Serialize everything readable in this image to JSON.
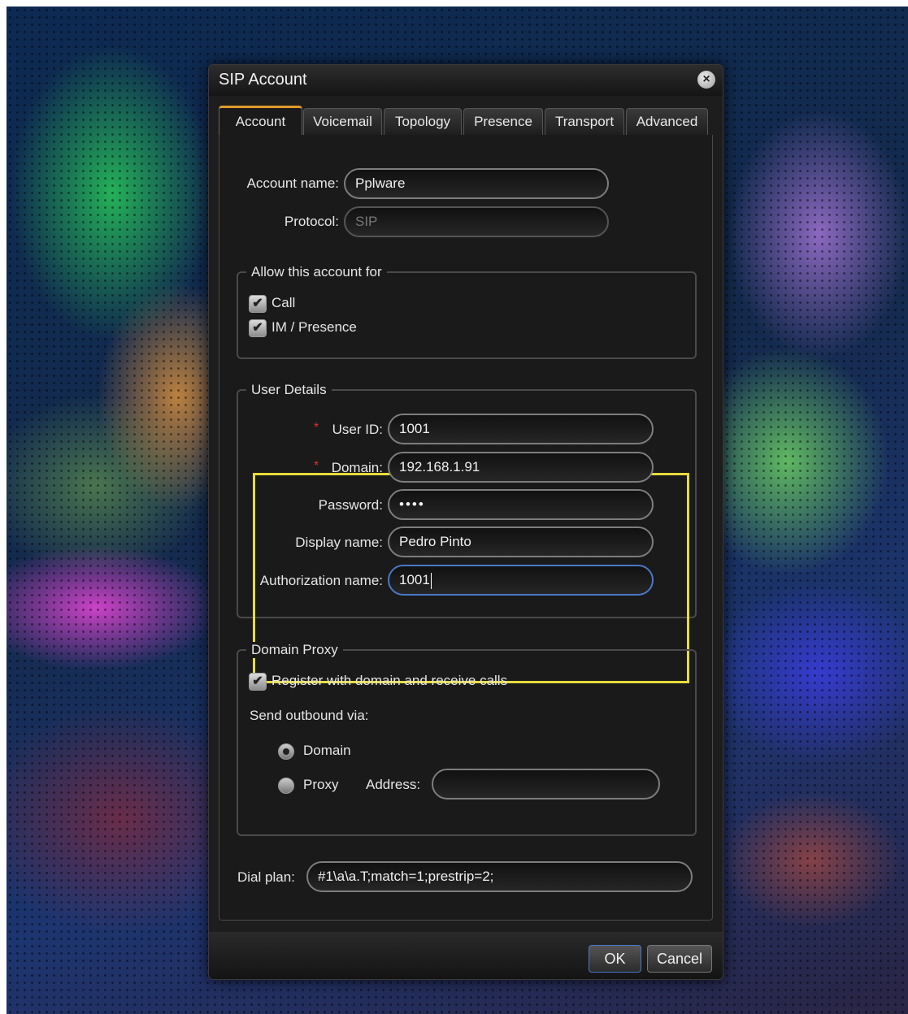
{
  "dialog": {
    "title": "SIP Account",
    "close_icon": "×"
  },
  "tabs": [
    {
      "label": "Account",
      "active": true
    },
    {
      "label": "Voicemail"
    },
    {
      "label": "Topology"
    },
    {
      "label": "Presence"
    },
    {
      "label": "Transport"
    },
    {
      "label": "Advanced"
    }
  ],
  "account": {
    "account_name_label": "Account name:",
    "account_name_value": "Pplware",
    "protocol_label": "Protocol:",
    "protocol_value": "SIP"
  },
  "allow": {
    "title": "Allow this account for",
    "call_label": "Call",
    "im_label": "IM / Presence",
    "call_checked": true,
    "im_checked": true,
    "check_mark": "✔"
  },
  "user_details": {
    "title": "User Details",
    "required_mark": "*",
    "user_id_label": "User ID:",
    "user_id_value": "1001",
    "domain_label": "Domain:",
    "domain_value": "192.168.1.91",
    "password_label": "Password:",
    "password_value": "••••",
    "display_name_label": "Display name:",
    "display_name_value": "Pedro Pinto",
    "auth_name_label": "Authorization name:",
    "auth_name_value": "1001"
  },
  "domain_proxy": {
    "title": "Domain Proxy",
    "register_label": "Register with domain and receive calls",
    "register_checked": true,
    "send_outbound_label": "Send outbound via:",
    "domain_option": "Domain",
    "proxy_option": "Proxy",
    "selected": "Domain",
    "address_label": "Address:",
    "address_value": ""
  },
  "dial_plan": {
    "label": "Dial plan:",
    "value": "#1\\a\\a.T;match=1;prestrip=2;"
  },
  "buttons": {
    "ok": "OK",
    "cancel": "Cancel"
  }
}
